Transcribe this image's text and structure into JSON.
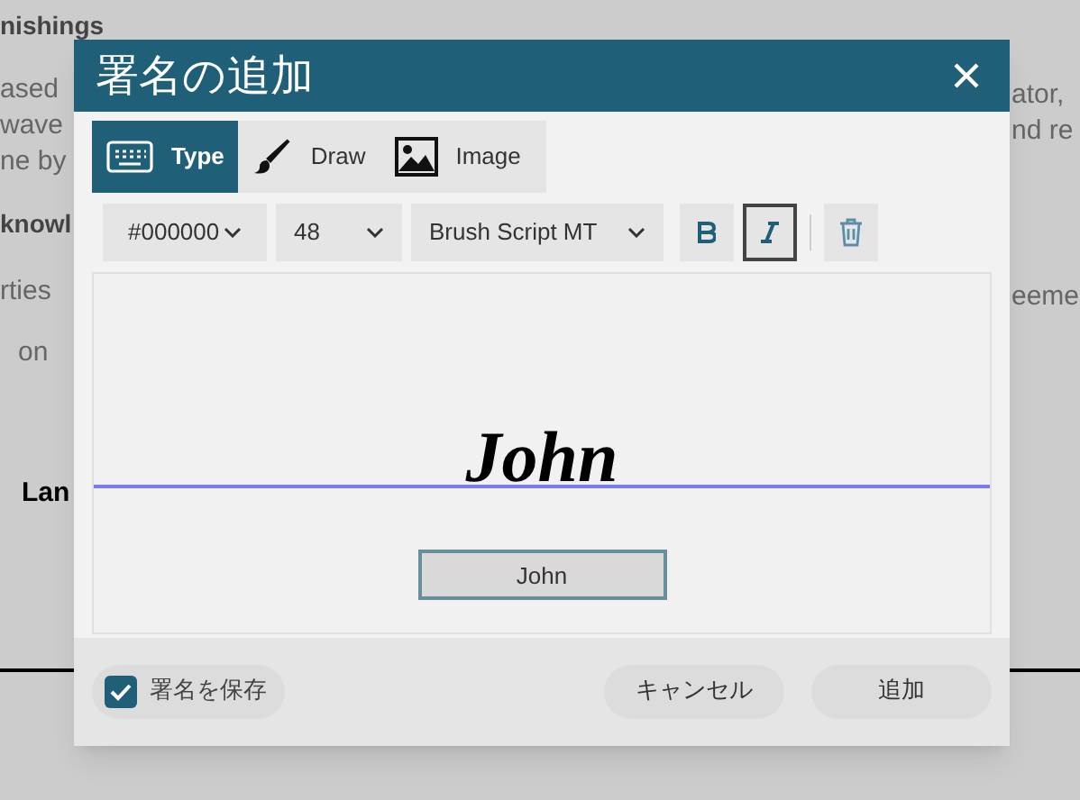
{
  "background": {
    "left_texts": [
      {
        "text": "nishings",
        "kind": "heading"
      },
      {
        "text": "ased",
        "kind": "body"
      },
      {
        "text": "wave",
        "kind": "body"
      },
      {
        "text": "ne by",
        "kind": "body"
      },
      {
        "text": "knowl",
        "kind": "heading"
      },
      {
        "text": "rties",
        "kind": "body"
      },
      {
        "text": "on",
        "kind": "body"
      },
      {
        "text": "Lan",
        "kind": "label"
      }
    ],
    "right_texts": [
      {
        "text": "ator,"
      },
      {
        "text": "nd re"
      },
      {
        "text": "eeme"
      }
    ]
  },
  "dialog": {
    "title": "署名の追加",
    "tabs": [
      {
        "label": "Type",
        "kind": "keyboard",
        "selected": true
      },
      {
        "label": "Draw",
        "kind": "brush",
        "selected": false
      },
      {
        "label": "Image",
        "kind": "image",
        "selected": false
      }
    ],
    "toolbar": {
      "color": "#000000",
      "size": "48",
      "font": "Brush Script MT",
      "bold": false,
      "italic": true
    },
    "signature": {
      "preview": "John",
      "input_value": "John"
    },
    "save_signature": {
      "label": "署名を保存",
      "checked": true
    },
    "buttons": [
      "キャンセル",
      "追加"
    ]
  }
}
